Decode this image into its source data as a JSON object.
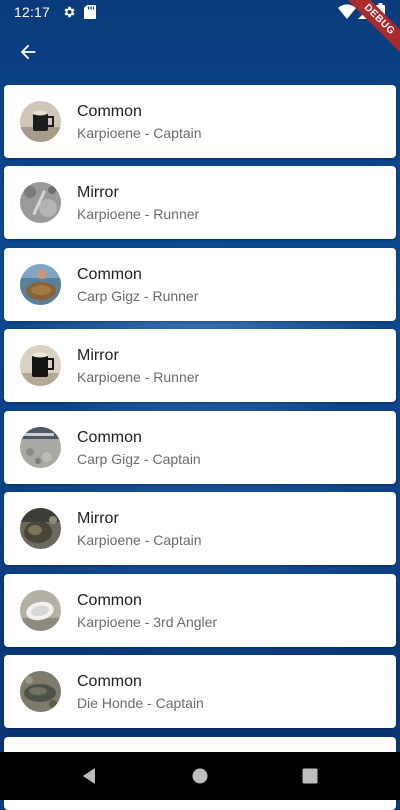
{
  "status_bar": {
    "time": "12:17",
    "icons": [
      "gear-icon",
      "sd-card-icon",
      "wifi-icon",
      "signal-icon",
      "battery-icon"
    ]
  },
  "app_bar": {
    "back_icon": "arrow-back-icon"
  },
  "debug_banner": "DEBUG",
  "items": [
    {
      "title": "Common",
      "subtitle": "Karpioene - Captain"
    },
    {
      "title": "Mirror",
      "subtitle": "Karpioene - Runner"
    },
    {
      "title": "Common",
      "subtitle": "Carp Gigz - Runner"
    },
    {
      "title": "Mirror",
      "subtitle": "Karpioene - Runner"
    },
    {
      "title": "Common",
      "subtitle": "Carp Gigz - Captain"
    },
    {
      "title": "Mirror",
      "subtitle": "Karpioene - Captain"
    },
    {
      "title": "Common",
      "subtitle": "Karpioene - 3rd Angler"
    },
    {
      "title": "Common",
      "subtitle": "Die Honde - Captain"
    }
  ],
  "nav_bar": [
    "back-triangle-icon",
    "home-circle-icon",
    "recents-square-icon"
  ]
}
